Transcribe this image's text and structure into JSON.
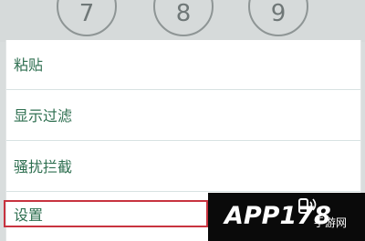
{
  "background": {
    "dial_keys": [
      "7",
      "8",
      "9"
    ]
  },
  "menu": {
    "items": [
      {
        "label": "粘贴"
      },
      {
        "label": "显示过滤"
      },
      {
        "label": "骚扰拦截"
      },
      {
        "label": "设置"
      }
    ],
    "highlighted_index": 3,
    "highlight_color": "#c8333f",
    "text_color": "#2e6f50"
  },
  "watermark": {
    "brand": "APP178",
    "suffix": "手游网"
  }
}
